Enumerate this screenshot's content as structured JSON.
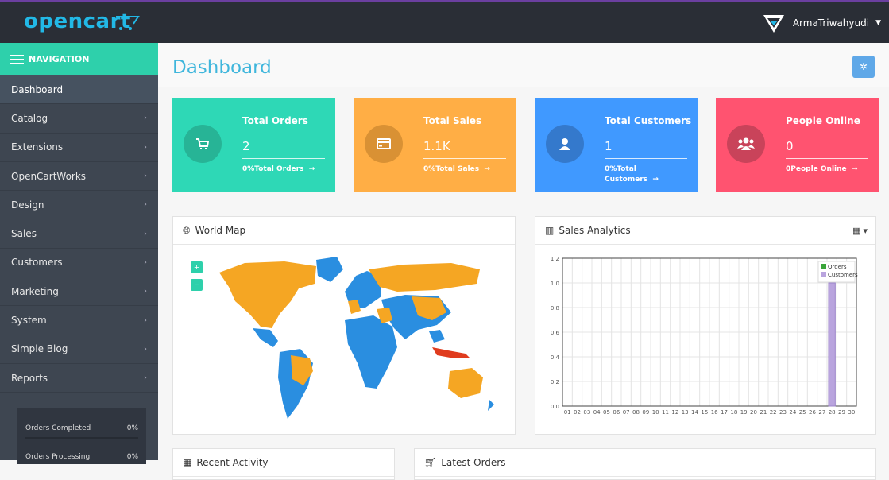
{
  "brand": {
    "name": "opencart"
  },
  "user": {
    "name": "ArmaTriwahyudi"
  },
  "nav": {
    "header": "NAVIGATION",
    "items": [
      {
        "label": "Dashboard",
        "has_children": false
      },
      {
        "label": "Catalog",
        "has_children": true
      },
      {
        "label": "Extensions",
        "has_children": true
      },
      {
        "label": "OpenCartWorks",
        "has_children": true
      },
      {
        "label": "Design",
        "has_children": true
      },
      {
        "label": "Sales",
        "has_children": true
      },
      {
        "label": "Customers",
        "has_children": true
      },
      {
        "label": "Marketing",
        "has_children": true
      },
      {
        "label": "System",
        "has_children": true
      },
      {
        "label": "Simple Blog",
        "has_children": true
      },
      {
        "label": "Reports",
        "has_children": true
      }
    ],
    "stats": [
      {
        "label": "Orders Completed",
        "value": "0%"
      },
      {
        "label": "Orders Processing",
        "value": "0%"
      }
    ]
  },
  "page": {
    "title": "Dashboard"
  },
  "tiles": [
    {
      "title": "Total Orders",
      "value": "2",
      "link": "0%Total Orders",
      "color": "#2ed8b6",
      "circle": "#27b496",
      "icon": "cart-icon"
    },
    {
      "title": "Total Sales",
      "value": "1.1K",
      "link": "0%Total Sales",
      "color": "#ffae45",
      "circle": "#d99134",
      "icon": "credit-card-icon"
    },
    {
      "title": "Total Customers",
      "value": "1",
      "link": "0%Total Customers",
      "color": "#4099ff",
      "circle": "#3479cc",
      "icon": "user-icon"
    },
    {
      "title": "People Online",
      "value": "0",
      "link": "0People Online",
      "color": "#ff5370",
      "circle": "#c9435a",
      "icon": "users-icon"
    }
  ],
  "world_map": {
    "title": "World Map",
    "zoom_in": "+",
    "zoom_out": "−"
  },
  "sales_analytics": {
    "title": "Sales Analytics",
    "chart_data": {
      "type": "bar",
      "categories": [
        "01",
        "02",
        "03",
        "04",
        "05",
        "06",
        "07",
        "08",
        "09",
        "10",
        "11",
        "12",
        "13",
        "14",
        "15",
        "16",
        "17",
        "18",
        "19",
        "20",
        "21",
        "22",
        "23",
        "24",
        "25",
        "26",
        "27",
        "28",
        "29",
        "30"
      ],
      "series": [
        {
          "name": "Orders",
          "color": "#3aa53a",
          "values": [
            0,
            0,
            0,
            0,
            0,
            0,
            0,
            0,
            0,
            0,
            0,
            0,
            0,
            0,
            0,
            0,
            0,
            0,
            0,
            0,
            0,
            0,
            0,
            0,
            0,
            0,
            0,
            0,
            0,
            0
          ]
        },
        {
          "name": "Customers",
          "color": "#b9a4de",
          "values": [
            0,
            0,
            0,
            0,
            0,
            0,
            0,
            0,
            0,
            0,
            0,
            0,
            0,
            0,
            0,
            0,
            0,
            0,
            0,
            0,
            0,
            0,
            0,
            0,
            0,
            0,
            0,
            1,
            0,
            0
          ]
        }
      ],
      "yticks": [
        "0.0",
        "0.2",
        "0.4",
        "0.6",
        "0.8",
        "1.0",
        "1.2"
      ],
      "ylim": [
        0,
        1.2
      ],
      "legend": "top-right"
    }
  },
  "bottom_panels": [
    {
      "title": "Recent Activity"
    },
    {
      "title": "Latest Orders"
    }
  ]
}
